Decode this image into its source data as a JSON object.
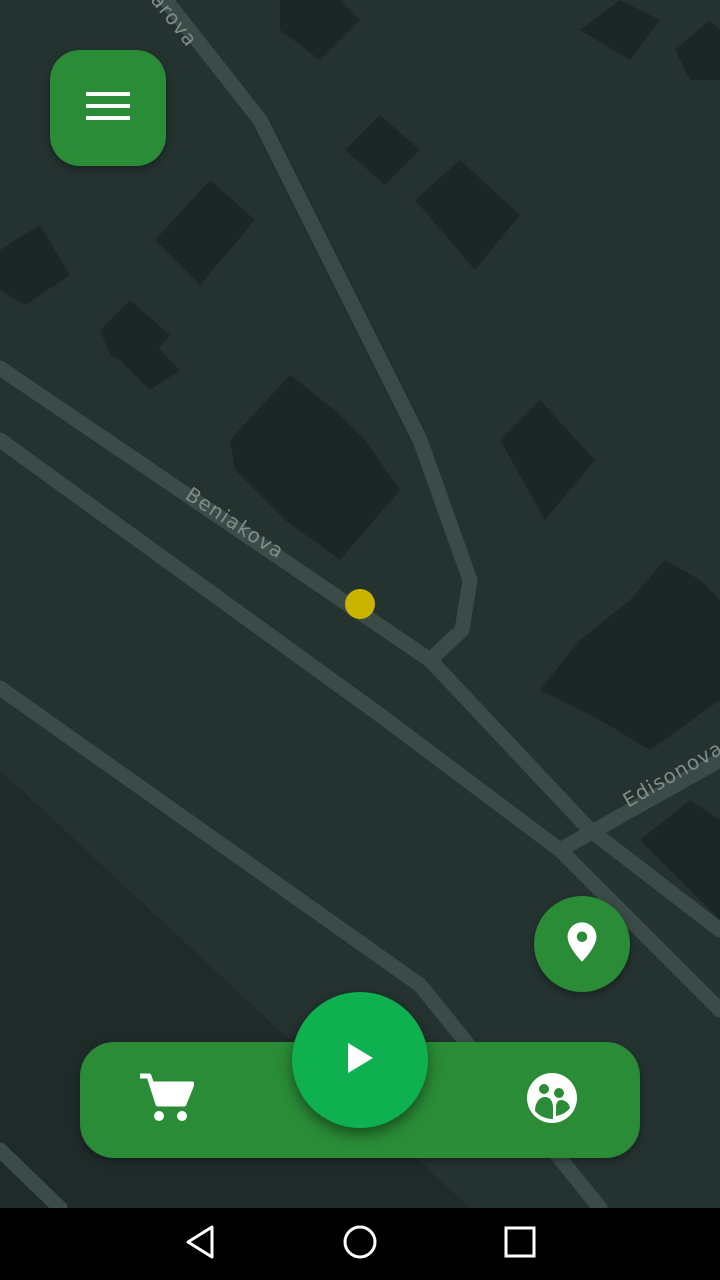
{
  "map": {
    "streets": [
      "Beniakova",
      "Edisonova",
      "arova"
    ],
    "user_marker_color": "#c9b400"
  },
  "controls": {
    "menu_icon": "hamburger-menu-icon",
    "location_icon": "map-pin-icon",
    "play_icon": "play-icon",
    "cart_icon": "shopping-cart-icon",
    "community_icon": "community-icon"
  },
  "system_nav": {
    "back_icon": "back-triangle-icon",
    "home_icon": "home-circle-icon",
    "recents_icon": "recents-square-icon"
  },
  "colors": {
    "accent": "#2a8c37",
    "play": "#0fb04f",
    "map_background": "#243230",
    "road": "#3b4b48"
  }
}
